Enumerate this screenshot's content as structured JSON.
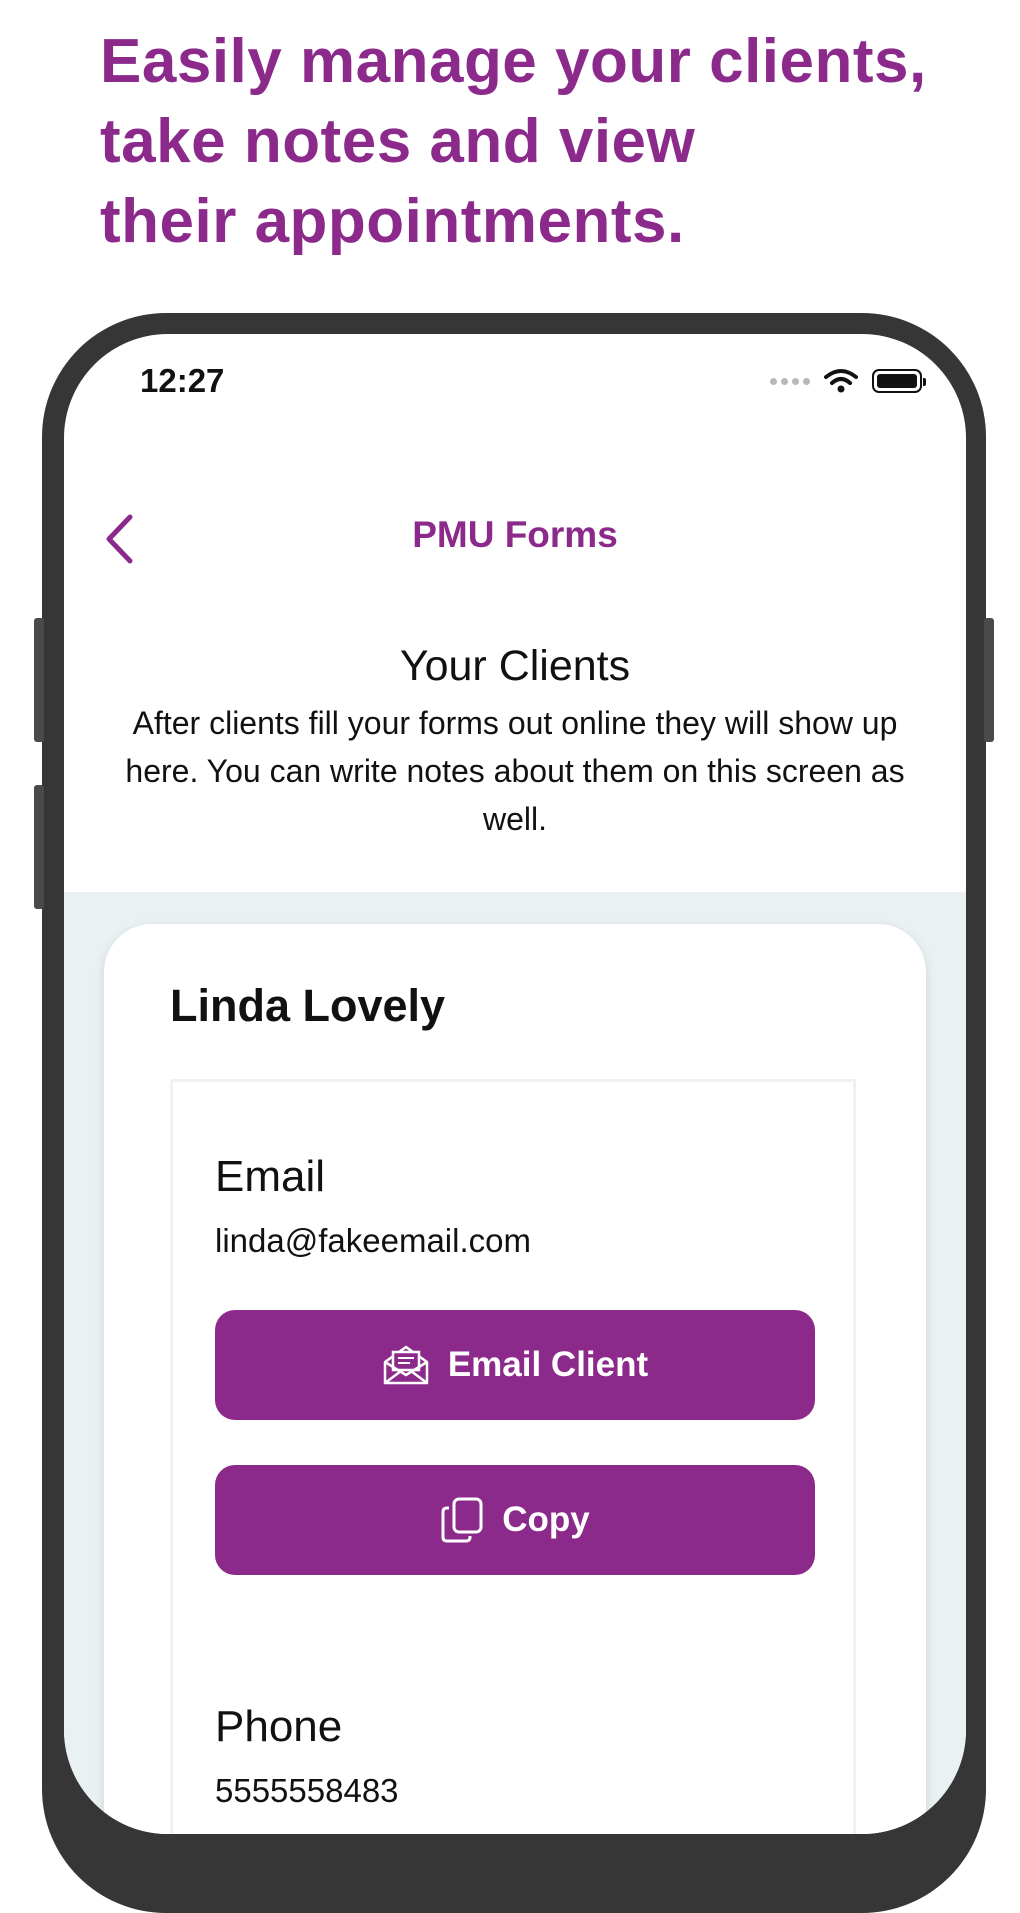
{
  "promo": {
    "headline_lines": [
      "Easily manage your clients,",
      "take notes and view",
      "their appointments."
    ]
  },
  "status_bar": {
    "time": "12:27"
  },
  "nav": {
    "title": "PMU Forms",
    "back_icon": "chevron-left-icon"
  },
  "section": {
    "title": "Your Clients",
    "description": "After clients fill your forms out online they will show up here.  You can write notes about them on this screen as well."
  },
  "client": {
    "name": "Linda Lovely",
    "email_label": "Email",
    "email": "linda@fakeemail.com",
    "email_button_label": "Email Client",
    "copy_button_label": "Copy",
    "phone_label": "Phone",
    "phone": "5555558483"
  },
  "colors": {
    "brand_purple": "#8c2a8c",
    "content_background": "#e9f1f3",
    "phone_frame": "#363636"
  }
}
